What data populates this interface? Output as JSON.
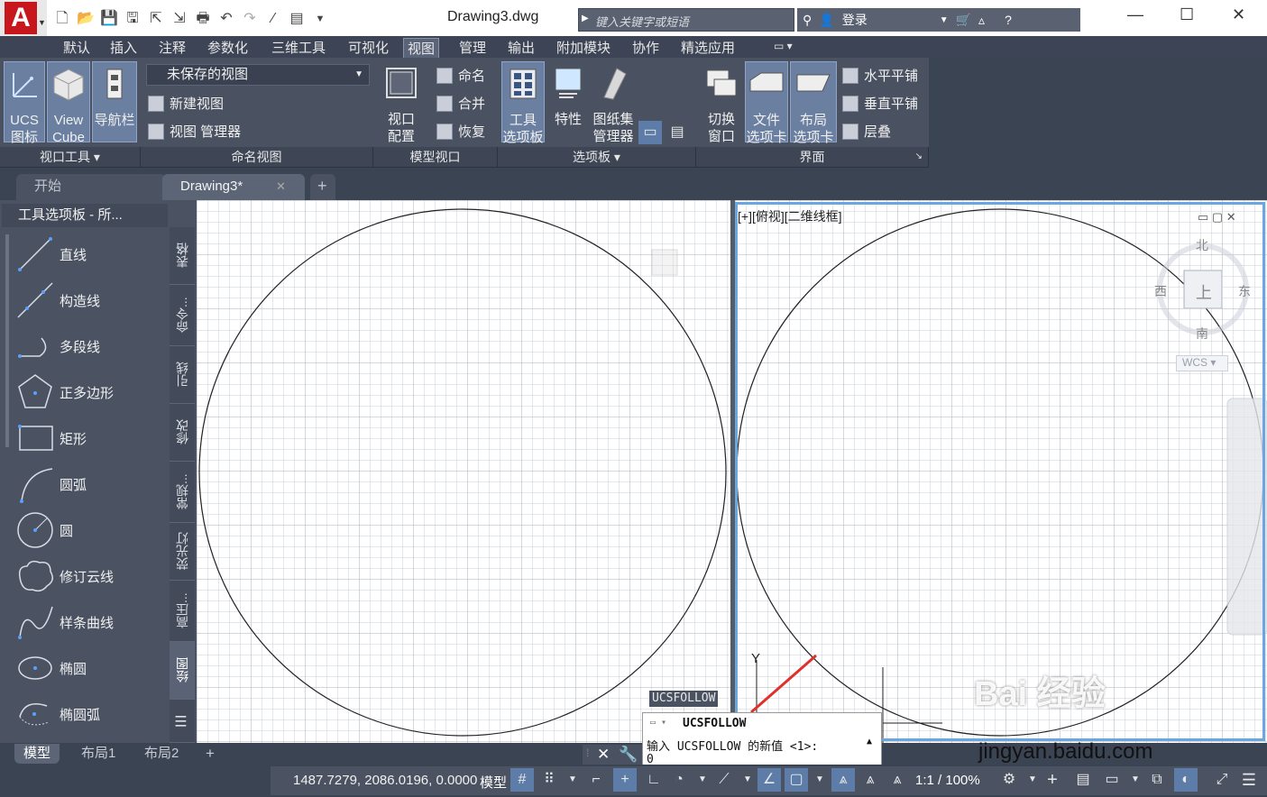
{
  "window": {
    "title": "Drawing3.dwg"
  },
  "search": {
    "placeholder": "键入关键字或短语"
  },
  "account": {
    "login": "登录"
  },
  "ribbon": {
    "tabs": [
      "默认",
      "插入",
      "注释",
      "参数化",
      "三维工具",
      "可视化",
      "视图",
      "管理",
      "输出",
      "附加模块",
      "协作",
      "精选应用"
    ],
    "active_tab": "视图",
    "viewport_tools": {
      "ucs1": "UCS",
      "ucs2": "图标",
      "cube1": "View",
      "cube2": "Cube",
      "nav": "导航栏",
      "footer": "视口工具"
    },
    "named_views": {
      "combo": "未保存的视图",
      "new": "新建视图",
      "manager": "视图 管理器",
      "footer": "命名视图"
    },
    "model_viewports": {
      "config1": "视口",
      "config2": "配置",
      "name": "命名",
      "join": "合并",
      "restore": "恢复",
      "footer": "模型视口"
    },
    "palettes": {
      "tool1": "工具",
      "tool2": "选项板",
      "props": "特性",
      "sheet1": "图纸集",
      "sheet2": "管理器",
      "footer": "选项板"
    },
    "interface": {
      "switch1": "切换",
      "switch2": "窗口",
      "file1": "文件",
      "file2": "选项卡",
      "layout1": "布局",
      "layout2": "选项卡",
      "tile_h": "水平平铺",
      "tile_v": "垂直平铺",
      "cascade": "层叠",
      "footer": "界面"
    }
  },
  "doc_tabs": {
    "start": "开始",
    "drawing": "Drawing3*"
  },
  "palette": {
    "title": "工具选项板 - 所...",
    "items": [
      "直线",
      "构造线",
      "多段线",
      "正多边形",
      "矩形",
      "圆弧",
      "圆",
      "修订云线",
      "样条曲线",
      "椭圆",
      "椭圆弧"
    ],
    "vtabs": [
      "表格",
      "命令...",
      "引线",
      "修改",
      "常规...",
      "荧光灯",
      "高压...",
      "绘图"
    ],
    "active_vtab": "绘图"
  },
  "viewport": {
    "label": "[+][俯视][二维线框]",
    "north": "北",
    "south": "南",
    "east": "东",
    "west": "西",
    "top": "上",
    "wcs": "WCS",
    "axis_y": "Y"
  },
  "command": {
    "tooltip": "UCSFOLLOW",
    "name": "UCSFOLLOW",
    "prompt": "输入 UCSFOLLOW 的新值 <1>:",
    "input": "0"
  },
  "layout_tabs": [
    "模型",
    "布局1",
    "布局2"
  ],
  "status": {
    "coords": "1487.7279, 2086.0196, 0.0000",
    "model": "模型",
    "scale": "1:1 / 100%"
  },
  "watermark": {
    "brand": "Bai 经验",
    "url": "jingyan.baidu.com"
  },
  "colors": {
    "accent": "#6aa6e0",
    "ribbon_bg": "#4a5262",
    "app_red": "#c8161d",
    "arrow_red": "#e0302a"
  }
}
